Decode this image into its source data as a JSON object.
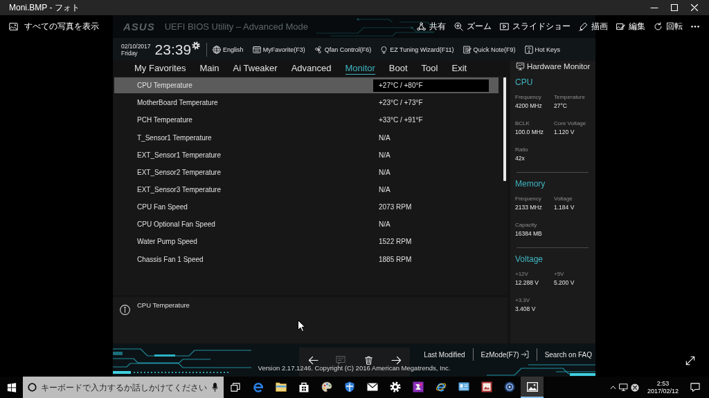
{
  "window": {
    "title": "Moni.BMP - フォト"
  },
  "photos_toolbar": {
    "back": "すべての写真を表示",
    "actions": [
      {
        "kind": "share",
        "label": "共有"
      },
      {
        "kind": "zoom",
        "label": "ズーム"
      },
      {
        "kind": "slideshow",
        "label": "スライドショー"
      },
      {
        "kind": "draw",
        "label": "描画"
      },
      {
        "kind": "edit",
        "label": "編集"
      },
      {
        "kind": "rotate",
        "label": "回転"
      }
    ]
  },
  "bios": {
    "logo": "ASUS",
    "title": "UEFI BIOS Utility – Advanced Mode",
    "date": "02/10/2017",
    "day": "Friday",
    "time": "23:39",
    "shortcuts": [
      {
        "kind": "language",
        "label": "English"
      },
      {
        "kind": "favorite",
        "label": "MyFavorite(F3)"
      },
      {
        "kind": "fan",
        "label": "Qfan Control(F6)"
      },
      {
        "kind": "tuning",
        "label": "EZ Tuning Wizard(F11)"
      },
      {
        "kind": "note",
        "label": "Quick Note(F9)"
      },
      {
        "kind": "hotkeys",
        "label": "Hot Keys"
      }
    ],
    "tabs": [
      {
        "label": "My Favorites",
        "selected": false
      },
      {
        "label": "Main",
        "selected": false
      },
      {
        "label": "Ai Tweaker",
        "selected": false
      },
      {
        "label": "Advanced",
        "selected": false
      },
      {
        "label": "Monitor",
        "selected": true
      },
      {
        "label": "Boot",
        "selected": false
      },
      {
        "label": "Tool",
        "selected": false
      },
      {
        "label": "Exit",
        "selected": false
      }
    ],
    "items": [
      {
        "name": "CPU Temperature",
        "value": "+27°C / +80°F",
        "selected": true
      },
      {
        "name": "MotherBoard Temperature",
        "value": "+23°C / +73°F",
        "selected": false
      },
      {
        "name": "PCH Temperature",
        "value": "+33°C / +91°F",
        "selected": false
      },
      {
        "name": "T_Sensor1 Temperature",
        "value": "N/A",
        "selected": false
      },
      {
        "name": "EXT_Sensor1 Temperature",
        "value": "N/A",
        "selected": false
      },
      {
        "name": "EXT_Sensor2 Temperature",
        "value": "N/A",
        "selected": false
      },
      {
        "name": "EXT_Sensor3 Temperature",
        "value": "N/A",
        "selected": false
      },
      {
        "name": "CPU Fan Speed",
        "value": "2073 RPM",
        "selected": false
      },
      {
        "name": "CPU Optional Fan Speed",
        "value": "N/A",
        "selected": false
      },
      {
        "name": "Water Pump Speed",
        "value": "1522 RPM",
        "selected": false
      },
      {
        "name": "Chassis Fan 1 Speed",
        "value": "1885 RPM",
        "selected": false
      }
    ],
    "help": {
      "text": "CPU Temperature"
    },
    "hardware_monitor": {
      "title": "Hardware Monitor",
      "sections": [
        {
          "title": "CPU",
          "fields": [
            {
              "label": "Frequency",
              "value": "4200 MHz"
            },
            {
              "label": "Temperature",
              "value": "27°C"
            },
            {
              "label": "BCLK",
              "value": "100.0 MHz"
            },
            {
              "label": "Core Voltage",
              "value": "1.120 V"
            },
            {
              "label": "Ratio",
              "value": "42x"
            }
          ]
        },
        {
          "title": "Memory",
          "fields": [
            {
              "label": "Frequency",
              "value": "2133 MHz"
            },
            {
              "label": "Voltage",
              "value": "1.184 V"
            },
            {
              "label": "Capacity",
              "value": "16384 MB"
            }
          ]
        },
        {
          "title": "Voltage",
          "fields": [
            {
              "label": "+12V",
              "value": "12.288 V"
            },
            {
              "label": "+5V",
              "value": "5.200 V"
            },
            {
              "label": "+3.3V",
              "value": "3.408 V"
            }
          ]
        }
      ]
    },
    "footer": {
      "actions": [
        {
          "kind": "text",
          "label": "Last Modified"
        },
        {
          "kind": "ezmode",
          "label": "EzMode(F7)"
        },
        {
          "kind": "text",
          "label": "Search on FAQ"
        }
      ],
      "version": "Version 2.17.1246. Copyright (C) 2016 American Megatrends, Inc."
    }
  },
  "photo_nav": [
    {
      "kind": "previous",
      "disabled": false
    },
    {
      "kind": "comment",
      "disabled": true
    },
    {
      "kind": "delete",
      "disabled": false
    },
    {
      "kind": "next",
      "disabled": false
    }
  ],
  "taskbar": {
    "search": {
      "placeholder": "キーボードで入力するか話しかけてください"
    },
    "apps": [
      {
        "kind": "letter-e",
        "selected": false
      },
      {
        "kind": "folder",
        "selected": false
      },
      {
        "kind": "bag",
        "selected": false
      },
      {
        "kind": "palette",
        "selected": false
      },
      {
        "kind": "shield",
        "selected": false
      },
      {
        "kind": "envelope",
        "selected": false
      },
      {
        "kind": "gear",
        "selected": false
      },
      {
        "kind": "tile",
        "selected": false
      },
      {
        "kind": "letter-e-ring",
        "selected": false
      },
      {
        "kind": "card",
        "selected": false
      },
      {
        "kind": "framed-picture",
        "selected": false
      },
      {
        "kind": "disc",
        "selected": false
      },
      {
        "kind": "picture",
        "selected": true
      }
    ],
    "clock": {
      "time": "2:53",
      "date": "2017/02/12"
    }
  }
}
